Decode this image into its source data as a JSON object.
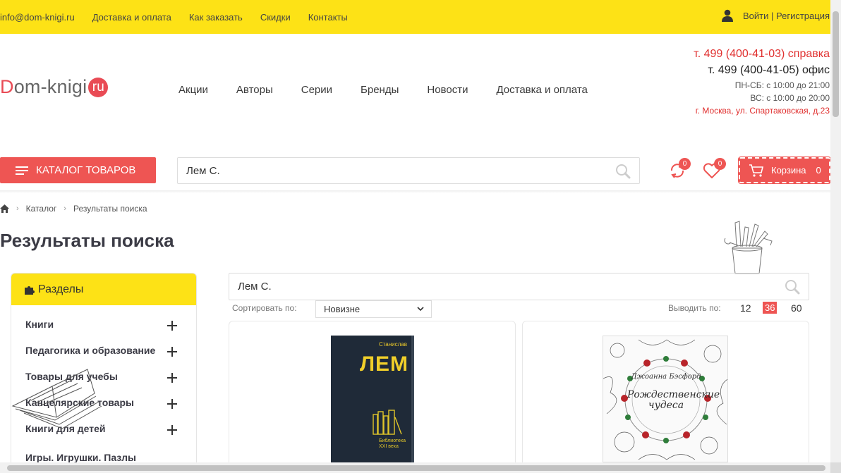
{
  "topbar": {
    "email": "info@dom-knigi.ru",
    "links": [
      "Доставка и оплата",
      "Как заказать",
      "Скидки",
      "Контакты"
    ],
    "login": "Войти",
    "register": "Регистрация"
  },
  "logo": {
    "d": "D",
    "rest": "om-knigi",
    "ru": "ru"
  },
  "nav": [
    "Акции",
    "Авторы",
    "Серии",
    "Бренды",
    "Новости",
    "Доставка и оплата"
  ],
  "contacts": {
    "phone1": "т. 499 (400-41-03) справка",
    "phone2": "т. 499 (400-41-05) офис",
    "hours1": "ПН-СБ: с 10:00 до 21:00",
    "hours2": "ВС: с 10:00 до 20:00",
    "address": "г. Москва, ул. Спартаковская, д.23"
  },
  "catalog_button": "КАТАЛОГ ТОВАРОВ",
  "search": {
    "value": "Лем С."
  },
  "compare_count": "0",
  "favorites_count": "0",
  "cart": {
    "label": "Корзина",
    "count": "0"
  },
  "breadcrumbs": [
    "Каталог",
    "Результаты поиска"
  ],
  "page_title": "Результаты поиска",
  "sidebar": {
    "title": "Разделы",
    "items": [
      "Книги",
      "Педагогика и образование",
      "Товары для учебы",
      "Канцелярские товары",
      "Книги для детей",
      "Игры. Игрушки. Пазлы"
    ]
  },
  "results": {
    "search_value": "Лем С.",
    "sort_label": "Сортировать по:",
    "sort_value": "Новизне",
    "per_page_label": "Выводить по:",
    "per_page": [
      "12",
      "36",
      "60"
    ],
    "per_page_active": "36"
  },
  "products": [
    {
      "cover_author": "Станислав",
      "cover_title": "ЛЕМ",
      "cover_series": "Библиотека XXI века"
    },
    {
      "cover_author": "Джоанна Бэсфорд",
      "cover_title": "Рождественские чудеса"
    }
  ],
  "colors": {
    "accent": "#ee5553",
    "yellow": "#fde216",
    "red_text": "#e0302f"
  }
}
